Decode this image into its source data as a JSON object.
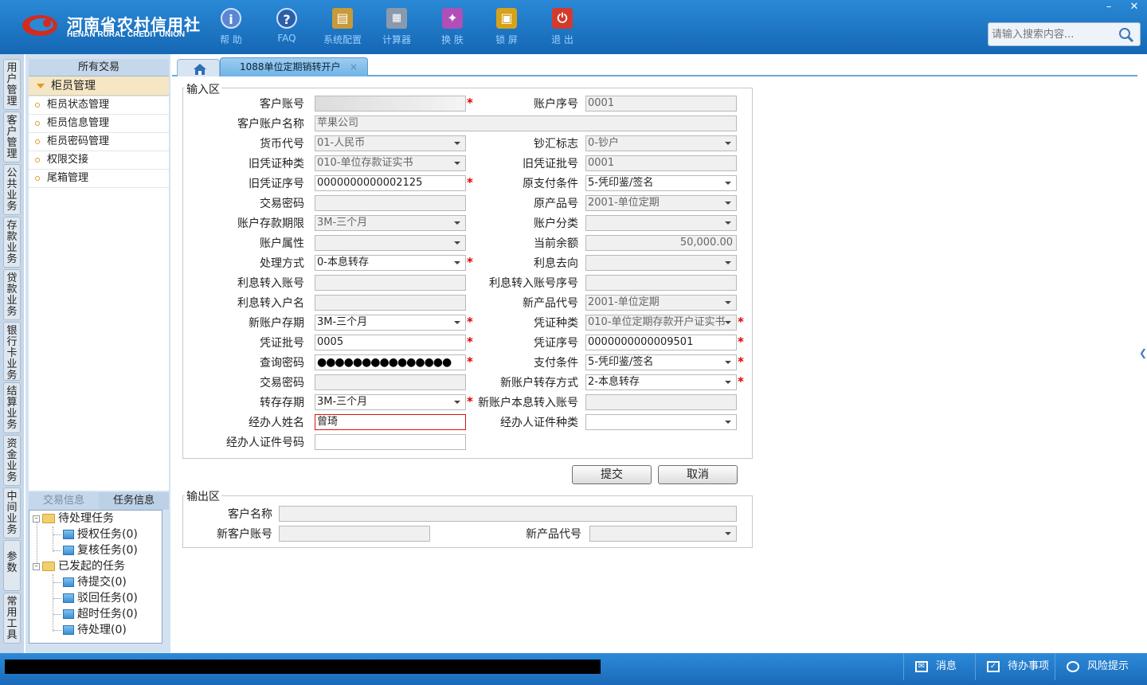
{
  "app": {
    "logo_cn": "河南省农村信用社",
    "logo_en": "HENAN RURAL CREDIT UNION"
  },
  "toolbar": [
    {
      "label": "帮 助",
      "icon": "info-icon",
      "color": "#5b86d6"
    },
    {
      "label": "FAQ",
      "icon": "question-icon",
      "color": "#2d5fa9"
    },
    {
      "label": "系统配置",
      "icon": "toolbox-icon",
      "color": "#c89a3a"
    },
    {
      "label": "计算器",
      "icon": "calculator-icon",
      "color": "#8a9aad"
    },
    {
      "label": "换 肤",
      "icon": "shirt-icon",
      "color": "#b04fb8"
    },
    {
      "label": "锁 屏",
      "icon": "lock-icon",
      "color": "#d6a21a"
    },
    {
      "label": "退 出",
      "icon": "power-icon",
      "color": "#d43a2c"
    }
  ],
  "window_controls": {
    "minimize": "–",
    "close": "✕"
  },
  "search": {
    "placeholder": "请输入搜索内容..."
  },
  "left_tabs": [
    "用户管理",
    "客户管理",
    "公共业务",
    "存款业务",
    "贷款业务",
    "银行卡业务",
    "结算业务",
    "资金业务",
    "中间业务",
    "参数",
    "常用工具"
  ],
  "sidebar": {
    "header": "所有交易",
    "group": "柜员管理",
    "items": [
      "柜员状态管理",
      "柜员信息管理",
      "柜员密码管理",
      "权限交接",
      "尾箱管理"
    ],
    "info_tabs": [
      "交易信息",
      "任务信息"
    ],
    "tree": {
      "pending": "待处理任务",
      "pending_children": [
        "授权任务(0)",
        "复核任务(0)"
      ],
      "initiated": "已发起的任务",
      "initiated_children": [
        "待提交(0)",
        "驳回任务(0)",
        "超时任务(0)",
        "待处理(0)"
      ]
    }
  },
  "tabs": {
    "active": "1088单位定期销转开户",
    "close": "×"
  },
  "input_section": {
    "title": "输入区",
    "labels": {
      "customer_account": "客户账号",
      "account_seq": "账户序号",
      "account_name": "客户账户名称",
      "currency": "货币代号",
      "cash_flag": "钞汇标志",
      "old_voucher_type": "旧凭证种类",
      "old_voucher_batch": "旧凭证批号",
      "old_voucher_seq": "旧凭证序号",
      "orig_pay_cond": "原支付条件",
      "tx_password": "交易密码",
      "orig_product": "原产品号",
      "deposit_term": "账户存款期限",
      "account_class": "账户分类",
      "account_attr": "账户属性",
      "current_balance": "当前余额",
      "process_method": "处理方式",
      "interest_dest": "利息去向",
      "interest_account": "利息转入账号",
      "interest_account_seq": "利息转入账号序号",
      "interest_name": "利息转入户名",
      "new_product": "新产品代号",
      "new_term": "新账户存期",
      "voucher_type": "凭证种类",
      "voucher_batch": "凭证批号",
      "voucher_seq": "凭证序号",
      "query_password": "查询密码",
      "pay_cond": "支付条件",
      "tx_password2": "交易密码",
      "new_transfer_method": "新账户转存方式",
      "transfer_term": "转存存期",
      "new_principal_account": "新账户本息转入账号",
      "agent_name": "经办人姓名",
      "agent_id_type": "经办人证件种类",
      "agent_id_no": "经办人证件号码"
    },
    "values": {
      "customer_account": "",
      "account_seq": "0001",
      "account_name": "苹果公司",
      "currency": "01-人民币",
      "cash_flag": "0-钞户",
      "old_voucher_type": "010-单位存款证实书",
      "old_voucher_batch": "0001",
      "old_voucher_seq": "0000000000002125",
      "orig_pay_cond": "5-凭印鉴/签名",
      "tx_password": "",
      "orig_product": "2001-单位定期",
      "deposit_term": "3M-三个月",
      "account_class": "",
      "account_attr": "",
      "current_balance": "50,000.00",
      "process_method": "0-本息转存",
      "interest_dest": "",
      "interest_account": "",
      "interest_account_seq": "",
      "interest_name": "",
      "new_product": "2001-单位定期",
      "new_term": "3M-三个月",
      "voucher_type": "010-单位定期存款开户证实书",
      "voucher_batch": "0005",
      "voucher_seq": "0000000000009501",
      "query_password": "●●●●●●●●●●●●●●●",
      "pay_cond": "5-凭印鉴/签名",
      "tx_password2": "",
      "new_transfer_method": "2-本息转存",
      "transfer_term": "3M-三个月",
      "new_principal_account": "",
      "agent_name": "曾琦",
      "agent_id_type": "",
      "agent_id_no": ""
    },
    "required_mark": "*"
  },
  "buttons": {
    "submit": "提交",
    "cancel": "取消"
  },
  "output_section": {
    "title": "输出区",
    "labels": {
      "customer_name": "客户名称",
      "new_account": "新客户账号",
      "new_product": "新产品代号"
    },
    "values": {
      "customer_name": "",
      "new_account": "",
      "new_product": ""
    }
  },
  "statusbar": {
    "message": "",
    "items": [
      {
        "label": "消息",
        "icon": "mail-icon"
      },
      {
        "label": "待办事项",
        "icon": "checkbox-icon"
      },
      {
        "label": "风险提示",
        "icon": "chat-icon"
      }
    ]
  }
}
